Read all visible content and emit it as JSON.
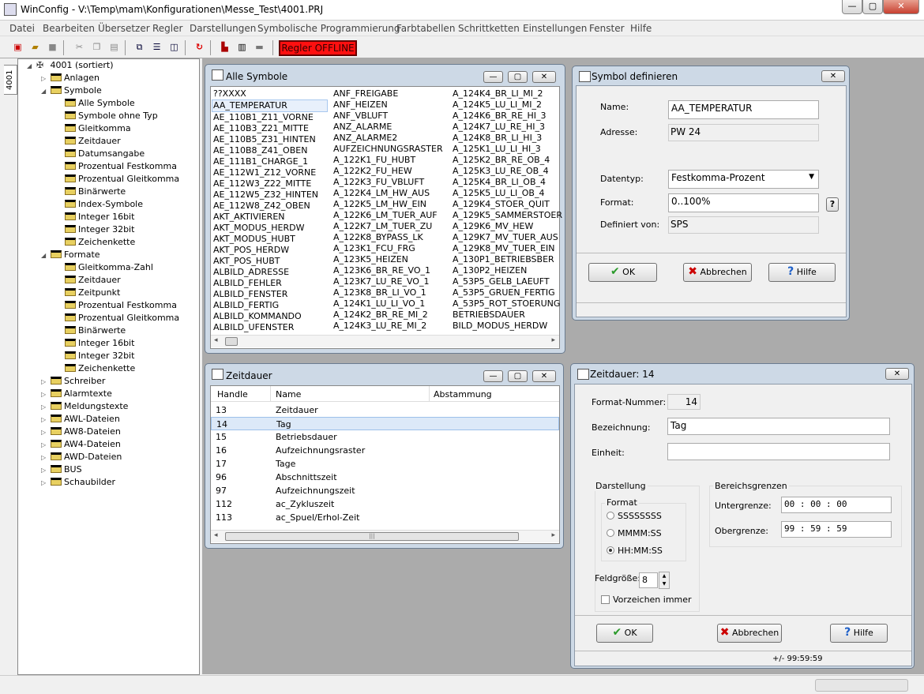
{
  "app": {
    "title": "WinConfig - V:\\Temp\\mam\\Konfigurationen\\Messe_Test\\4001.PRJ",
    "min": "—",
    "max": "▢",
    "close": "✕"
  },
  "menu": [
    "Datei",
    "Bearbeiten",
    "Übersetzer",
    "Regler",
    "Darstellungen",
    "Symbolische Programmierung",
    "Farbtabellen",
    "Schrittketten",
    "Einstellungen",
    "Fenster",
    "Hilfe"
  ],
  "toolbar": {
    "status": "Regler OFFLINE"
  },
  "tree": {
    "tab": "4001",
    "root": "4001 (sortiert)",
    "nodes": [
      {
        "label": "Anlagen",
        "level": 1
      },
      {
        "label": "Symbole",
        "level": 1,
        "open": true
      },
      {
        "label": "Alle Symbole",
        "level": 2
      },
      {
        "label": "Symbole ohne Typ",
        "level": 2
      },
      {
        "label": "Gleitkomma",
        "level": 2
      },
      {
        "label": "Zeitdauer",
        "level": 2
      },
      {
        "label": "Datumsangabe",
        "level": 2
      },
      {
        "label": "Prozentual Festkomma",
        "level": 2
      },
      {
        "label": "Prozentual Gleitkomma",
        "level": 2
      },
      {
        "label": "Binärwerte",
        "level": 2
      },
      {
        "label": "Index-Symbole",
        "level": 2
      },
      {
        "label": "Integer 16bit",
        "level": 2
      },
      {
        "label": "Integer 32bit",
        "level": 2
      },
      {
        "label": "Zeichenkette",
        "level": 2
      },
      {
        "label": "Formate",
        "level": 1,
        "open": true
      },
      {
        "label": "Gleitkomma-Zahl",
        "level": 2
      },
      {
        "label": "Zeitdauer",
        "level": 2
      },
      {
        "label": "Zeitpunkt",
        "level": 2
      },
      {
        "label": "Prozentual Festkomma",
        "level": 2
      },
      {
        "label": "Prozentual Gleitkomma",
        "level": 2
      },
      {
        "label": "Binärwerte",
        "level": 2
      },
      {
        "label": "Integer 16bit",
        "level": 2
      },
      {
        "label": "Integer 32bit",
        "level": 2
      },
      {
        "label": "Zeichenkette",
        "level": 2
      },
      {
        "label": "Schreiber",
        "level": 1
      },
      {
        "label": "Alarmtexte",
        "level": 1
      },
      {
        "label": "Meldungstexte",
        "level": 1
      },
      {
        "label": "AWL-Dateien",
        "level": 1
      },
      {
        "label": "AW8-Dateien",
        "level": 1
      },
      {
        "label": "AW4-Dateien",
        "level": 1
      },
      {
        "label": "AWD-Dateien",
        "level": 1
      },
      {
        "label": "BUS",
        "level": 1
      },
      {
        "label": "Schaubilder",
        "level": 1
      }
    ]
  },
  "alle_symbole": {
    "title": "Alle Symbole",
    "col1": [
      "??XXXX",
      "AA_TEMPERATUR",
      "AE_110B1_Z11_VORNE",
      "AE_110B3_Z21_MITTE",
      "AE_110B5_Z31_HINTEN",
      "AE_110B8_Z41_OBEN",
      "AE_111B1_CHARGE_1",
      "AE_112W1_Z12_VORNE",
      "AE_112W3_Z22_MITTE",
      "AE_112W5_Z32_HINTEN",
      "AE_112W8_Z42_OBEN",
      "AKT_AKTIVIEREN",
      "AKT_MODUS_HERDW",
      "AKT_MODUS_HUBT",
      "AKT_POS_HERDW",
      "AKT_POS_HUBT",
      "ALBILD_ADRESSE",
      "ALBILD_FEHLER",
      "ALBILD_FENSTER",
      "ALBILD_FERTIG",
      "ALBILD_KOMMANDO",
      "ALBILD_UFENSTER"
    ],
    "col2": [
      "ANF_FREIGABE",
      "ANF_HEIZEN",
      "ANF_VBLUFT",
      "ANZ_ALARME",
      "ANZ_ALARME2",
      "AUFZEICHNUNGSRASTER",
      "A_122K1_FU_HUBT",
      "A_122K2_FU_HEW",
      "A_122K3_FU_VBLUFT",
      "A_122K4_LM_HW_AUS",
      "A_122K5_LM_HW_EIN",
      "A_122K6_LM_TUER_AUF",
      "A_122K7_LM_TUER_ZU",
      "A_122K8_BYPASS_LK",
      "A_123K1_FCU_FRG",
      "A_123K5_HEIZEN",
      "A_123K6_BR_RE_VO_1",
      "A_123K7_LU_RE_VO_1",
      "A_123K8_BR_LI_VO_1",
      "A_124K1_LU_LI_VO_1",
      "A_124K2_BR_RE_MI_2",
      "A_124K3_LU_RE_MI_2"
    ],
    "col3": [
      "A_124K4_BR_LI_MI_2",
      "A_124K5_LU_LI_MI_2",
      "A_124K6_BR_RE_HI_3",
      "A_124K7_LU_RE_HI_3",
      "A_124K8_BR_LI_HI_3",
      "A_125K1_LU_LI_HI_3",
      "A_125K2_BR_RE_OB_4",
      "A_125K3_LU_RE_OB_4",
      "A_125K4_BR_LI_OB_4",
      "A_125K5_LU_LI_OB_4",
      "A_129K4_STOER_QUIT",
      "A_129K5_SAMMERSTOER",
      "A_129K6_MV_HEW",
      "A_129K7_MV_TUER_AUS",
      "A_129K8_MV_TUER_EIN",
      "A_130P1_BETRIEBSBER",
      "A_130P2_HEIZEN",
      "A_53P5_GELB_LAEUFT",
      "A_53P5_GRUEN_FERTIG",
      "A_53P5_ROT_STOERUNG",
      "BETRIEBSDAUER",
      "BILD_MODUS_HERDW"
    ]
  },
  "symbol_definieren": {
    "title": "Symbol definieren",
    "name_label": "Name:",
    "name_value": "AA_TEMPERATUR",
    "adresse_label": "Adresse:",
    "adresse_value": "PW 24",
    "datentyp_label": "Datentyp:",
    "datentyp_value": "Festkomma-Prozent",
    "format_label": "Format:",
    "format_value": "0..100%",
    "definiert_label": "Definiert von:",
    "definiert_value": "SPS",
    "help_small": "?",
    "ok": "OK",
    "cancel": "Abbrechen",
    "help": "Hilfe"
  },
  "zeitdauer_list": {
    "title": "Zeitdauer",
    "headers": [
      "Handle",
      "Name",
      "Abstammung"
    ],
    "rows": [
      {
        "handle": "13",
        "name": "Zeitdauer"
      },
      {
        "handle": "14",
        "name": "Tag"
      },
      {
        "handle": "15",
        "name": "Betriebsdauer"
      },
      {
        "handle": "16",
        "name": "Aufzeichnungsraster"
      },
      {
        "handle": "17",
        "name": "Tage"
      },
      {
        "handle": "96",
        "name": "Abschnittszeit"
      },
      {
        "handle": "97",
        "name": "Aufzeichnungszeit"
      },
      {
        "handle": "112",
        "name": "ac_Zykluszeit"
      },
      {
        "handle": "113",
        "name": "ac_Spuel/Erhol-Zeit"
      }
    ]
  },
  "zeitdauer_detail": {
    "title": "Zeitdauer: 14",
    "formatnr_label": "Format-Nummer:",
    "formatnr_value": "14",
    "bez_label": "Bezeichnung:",
    "bez_value": "Tag",
    "einheit_label": "Einheit:",
    "einheit_value": "",
    "darstellung_label": "Darstellung",
    "format_label": "Format",
    "radio_options": [
      "SSSSSSSS",
      "MMMM:SS",
      "HH:MM:SS"
    ],
    "selected": "HH:MM:SS",
    "bereich_label": "Bereichsgrenzen",
    "unter_label": "Untergrenze:",
    "unter_value": "00 : 00 : 00",
    "ober_label": "Obergrenze:",
    "ober_value": "99 : 59 : 59",
    "feld_label": "Feldgröße:",
    "feld_value": "8",
    "vorzeichen_label": "Vorzeichen immer",
    "ok": "OK",
    "cancel": "Abbrechen",
    "help": "Hilfe",
    "status": "+/- 99:59:59"
  }
}
